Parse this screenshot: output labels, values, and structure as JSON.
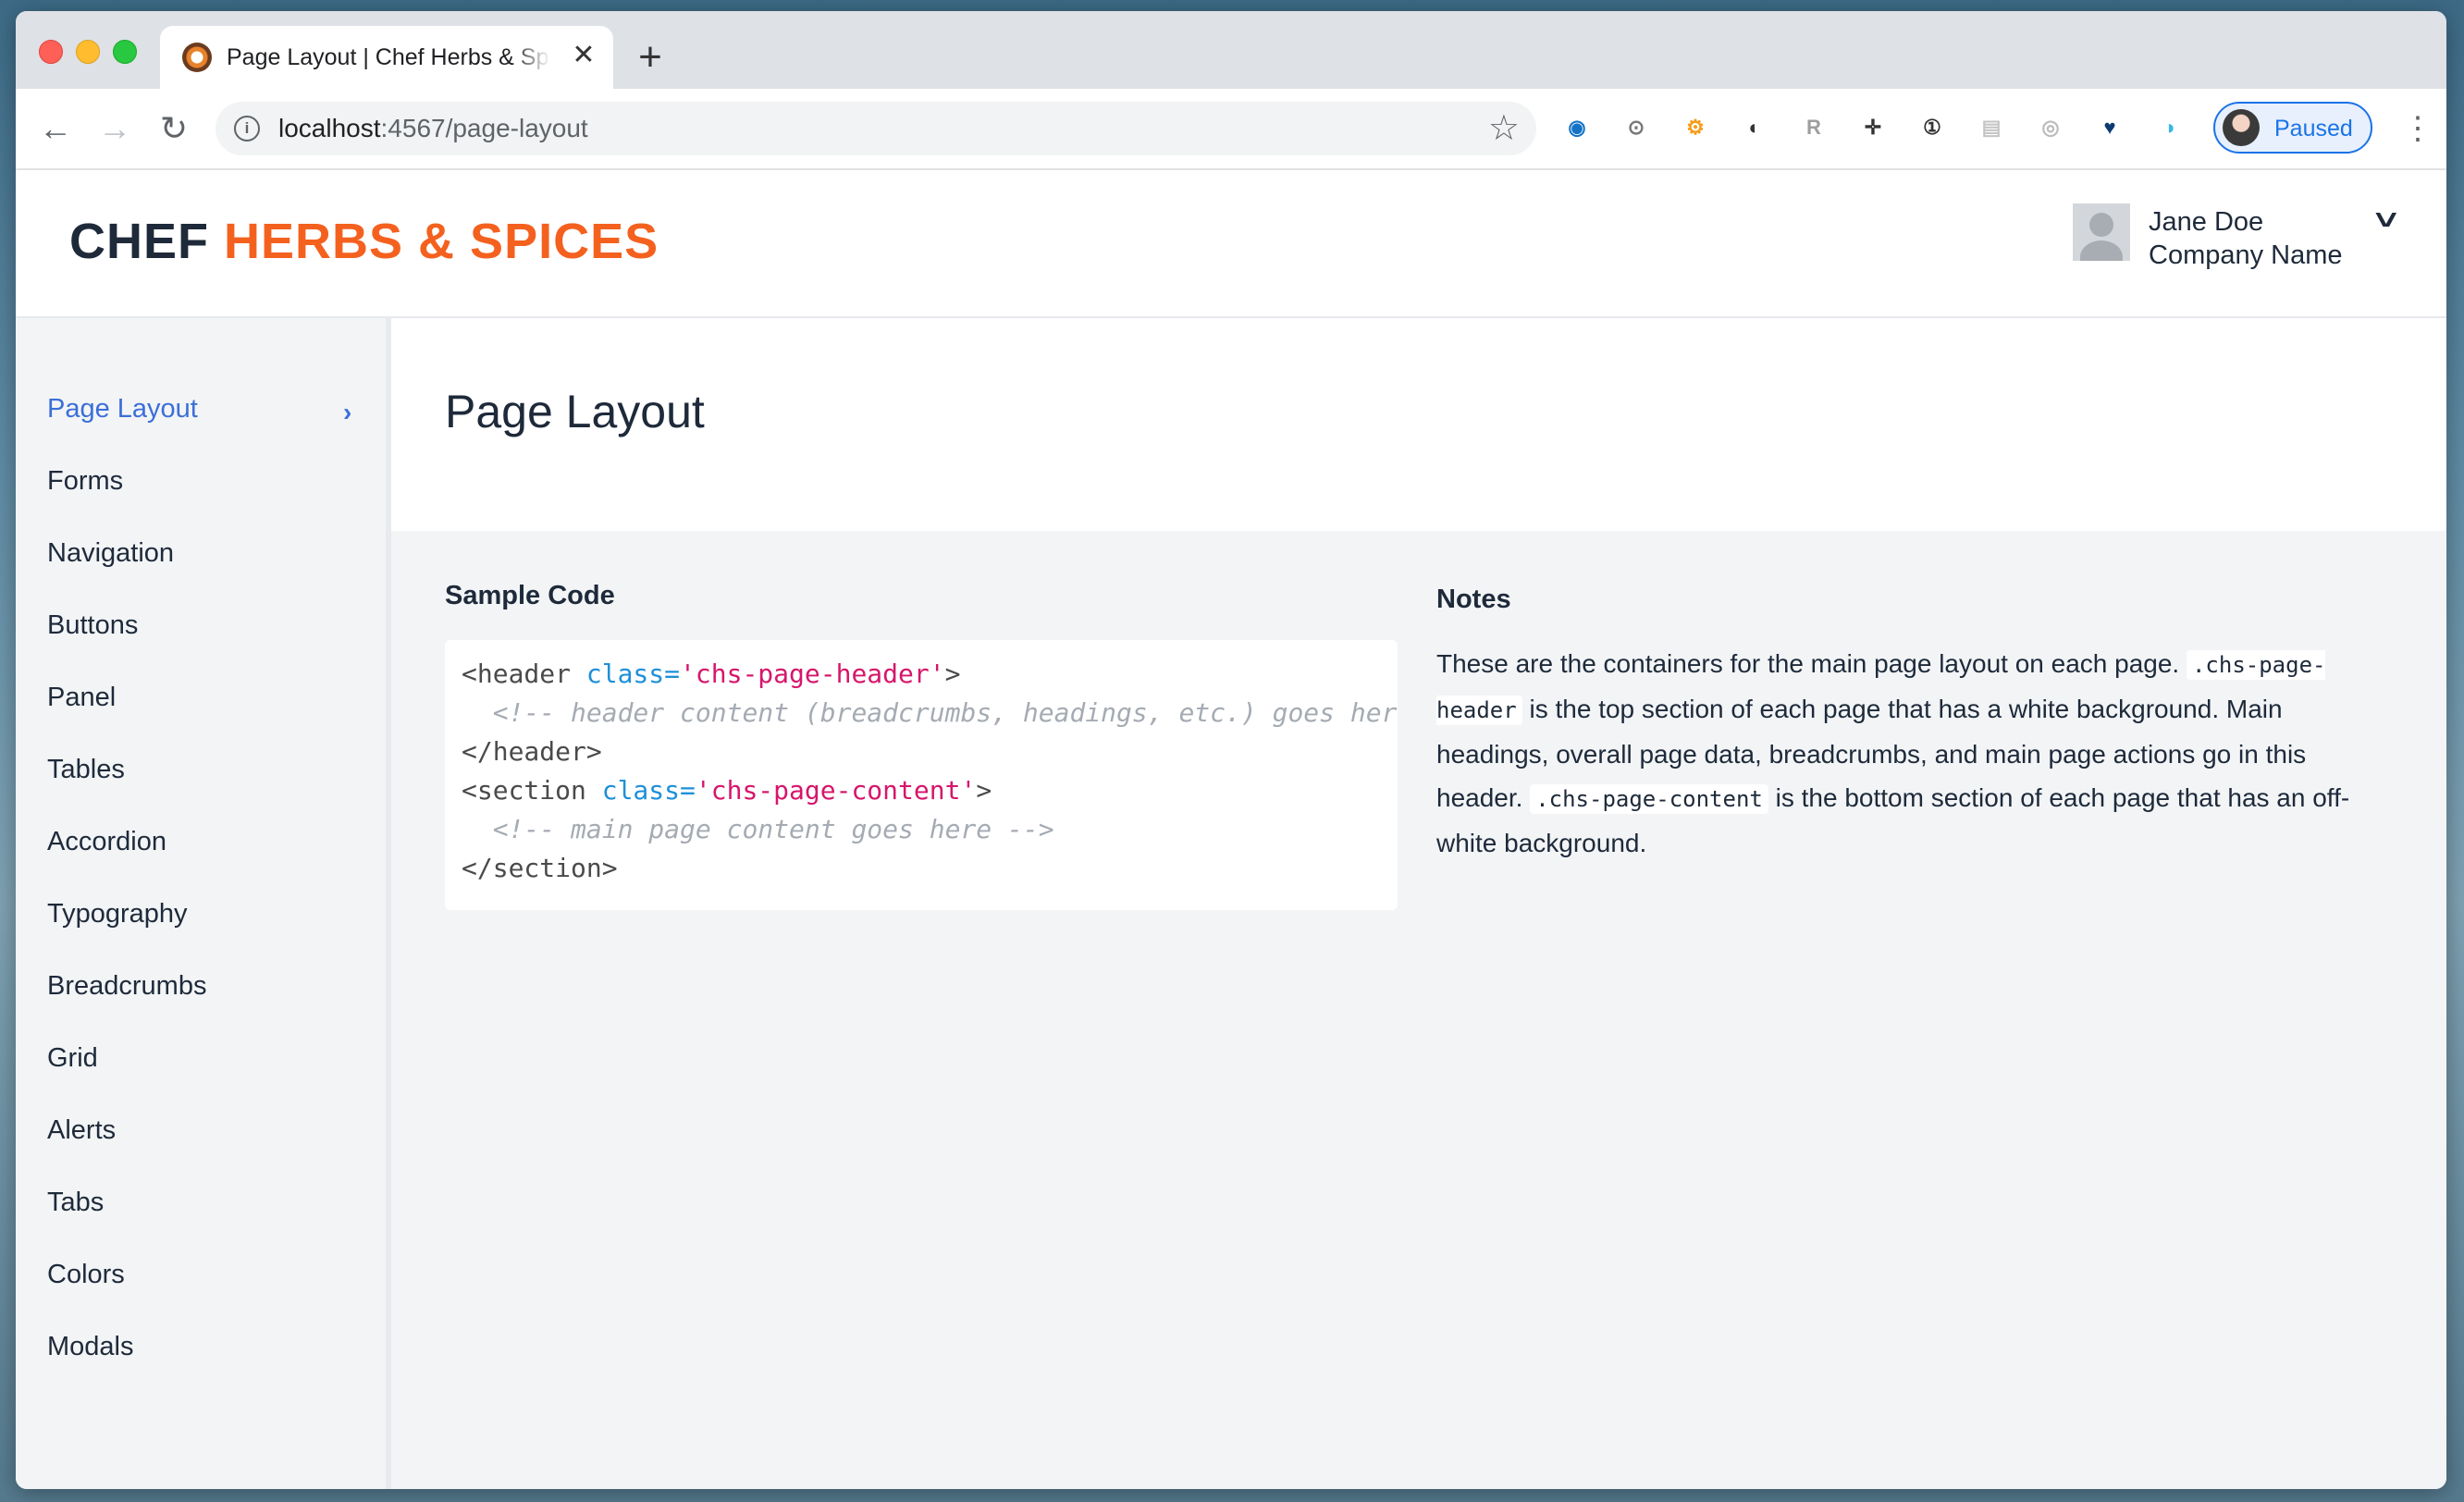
{
  "browser": {
    "tab_title": "Page Layout | Chef Herbs & Spices",
    "url_host": "localhost",
    "url_path": ":4567/page-layout",
    "profile_label": "Paused",
    "extensions": [
      {
        "name": "ext-blue-circle-icon",
        "glyph": "◉",
        "color": "#1473c7"
      },
      {
        "name": "ext-coin-icon",
        "glyph": "⊙",
        "color": "#777777"
      },
      {
        "name": "ext-orange-gear-icon",
        "glyph": "⚙",
        "color": "#f59c1a"
      },
      {
        "name": "ext-flame-icon",
        "glyph": "◐",
        "color": "#333333"
      },
      {
        "name": "ext-r-icon",
        "glyph": "R",
        "color": "#9e9e9e"
      },
      {
        "name": "ext-crosshair-icon",
        "glyph": "✛",
        "color": "#333333"
      },
      {
        "name": "ext-1password-icon",
        "glyph": "①",
        "color": "#333333"
      },
      {
        "name": "ext-printer-icon",
        "glyph": "▤",
        "color": "#c4c4c4"
      },
      {
        "name": "ext-target-icon",
        "glyph": "◎",
        "color": "#bbbbbb"
      },
      {
        "name": "ext-heart-icon",
        "glyph": "♥",
        "color": "#0d3a72"
      },
      {
        "name": "ext-wave-icon",
        "glyph": "◑",
        "color": "#37b7e6"
      }
    ]
  },
  "header": {
    "brand_part1": "CHEF",
    "brand_part2": "HERBS & SPICES",
    "user_name": "Jane Doe",
    "company_name": "Company Name"
  },
  "sidebar": {
    "items": [
      {
        "label": "Page Layout",
        "active": true
      },
      {
        "label": "Forms"
      },
      {
        "label": "Navigation"
      },
      {
        "label": "Buttons"
      },
      {
        "label": "Panel"
      },
      {
        "label": "Tables"
      },
      {
        "label": "Accordion"
      },
      {
        "label": "Typography"
      },
      {
        "label": "Breadcrumbs"
      },
      {
        "label": "Grid"
      },
      {
        "label": "Alerts"
      },
      {
        "label": "Tabs"
      },
      {
        "label": "Colors"
      },
      {
        "label": "Modals"
      }
    ]
  },
  "main": {
    "title": "Page Layout",
    "sample_code_label": "Sample Code",
    "notes_label": "Notes",
    "code": {
      "l1_open": "<header ",
      "l1_attr": "class=",
      "l1_str": "'chs-page-header'",
      "l1_close": ">",
      "l2_comment": "<!-- header content (breadcrumbs, headings, etc.) goes here -->",
      "l3": "</header>",
      "l4_open": "<section ",
      "l4_attr": "class=",
      "l4_str": "'chs-page-content'",
      "l4_close": ">",
      "l5_comment": "<!-- main page content goes here -->",
      "l6": "</section>"
    },
    "notes": {
      "t1": "These are the containers for the main page layout on each page.",
      "c1": ".chs-page-header",
      "t2": "is the top section of each page that has a white background. Main headings, overall page data, breadcrumbs, and main page actions go in this header.",
      "c2": ".chs-page-content",
      "t3": "is the bottom section of each page that has an off-white background."
    }
  }
}
